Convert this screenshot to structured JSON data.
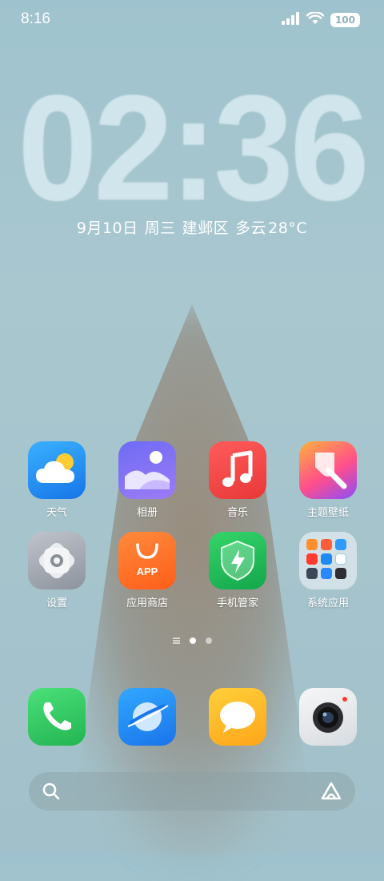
{
  "status": {
    "time": "8:16",
    "battery": "100"
  },
  "lockclock": {
    "time": "02:36"
  },
  "date": {
    "day": "9月10日",
    "weekday": "周三",
    "location": "建邺区",
    "weather": "多云",
    "temperature": "28°C"
  },
  "apps": [
    {
      "label": "天气",
      "icon": "weather-icon"
    },
    {
      "label": "相册",
      "icon": "gallery-icon"
    },
    {
      "label": "音乐",
      "icon": "music-icon"
    },
    {
      "label": "主题壁纸",
      "icon": "themes-icon"
    },
    {
      "label": "设置",
      "icon": "settings-icon"
    },
    {
      "label": "应用商店",
      "icon": "app-store-icon",
      "badge_text": "APP"
    },
    {
      "label": "手机管家",
      "icon": "security-icon"
    },
    {
      "label": "系统应用",
      "icon": "folder-icon"
    }
  ],
  "dock": [
    {
      "icon": "phone-icon"
    },
    {
      "icon": "browser-icon"
    },
    {
      "icon": "messages-icon"
    },
    {
      "icon": "camera-icon"
    }
  ],
  "colors": {
    "accent_blue": "#1e8af5",
    "green": "#34c759",
    "red": "#f14a4a",
    "orange": "#ff7a2f"
  }
}
